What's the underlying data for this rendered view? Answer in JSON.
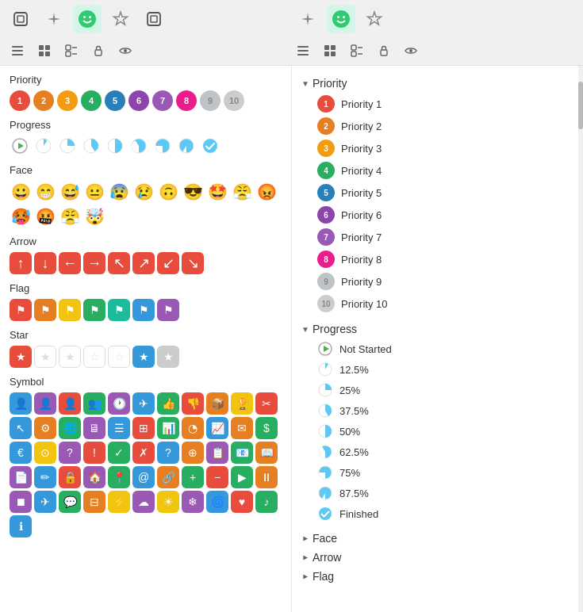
{
  "toolbar": {
    "left": [
      {
        "name": "square-icon",
        "symbol": "⊡",
        "active": false
      },
      {
        "name": "sparkle-icon",
        "symbol": "✦",
        "active": false
      },
      {
        "name": "smiley-icon",
        "symbol": "😊",
        "active": true
      },
      {
        "name": "star-outline-icon",
        "symbol": "✿",
        "active": false
      },
      {
        "name": "square2-icon",
        "symbol": "⊡",
        "active": false
      }
    ],
    "right": [
      {
        "name": "sparkle2-icon",
        "symbol": "✦",
        "active": false
      },
      {
        "name": "smiley2-icon",
        "symbol": "😊",
        "active": true
      },
      {
        "name": "star2-icon",
        "symbol": "✿",
        "active": false
      }
    ]
  },
  "subToolbar": {
    "left": [
      "list",
      "grid",
      "expand",
      "lock",
      "eye"
    ],
    "right": [
      "list",
      "grid",
      "expand",
      "lock",
      "eye"
    ]
  },
  "leftPanel": {
    "sections": [
      {
        "label": "Priority",
        "type": "priority"
      },
      {
        "label": "Progress",
        "type": "progress"
      },
      {
        "label": "Face",
        "type": "face"
      },
      {
        "label": "Arrow",
        "type": "arrow"
      },
      {
        "label": "Flag",
        "type": "flag"
      },
      {
        "label": "Star",
        "type": "star"
      },
      {
        "label": "Symbol",
        "type": "symbol"
      }
    ],
    "priority": {
      "colors": [
        "#e74c3c",
        "#e67e22",
        "#f39c12",
        "#27ae60",
        "#2980b9",
        "#8e44ad",
        "#9b59b6",
        "#e91e8c",
        "#bdc3c7",
        "#ccc"
      ],
      "labels": [
        "1",
        "2",
        "3",
        "4",
        "5",
        "6",
        "7",
        "8",
        "9",
        "10"
      ]
    }
  },
  "rightPanel": {
    "categories": [
      {
        "name": "Priority",
        "expanded": true,
        "items": [
          {
            "label": "Priority 1",
            "color": "#e74c3c",
            "num": "1"
          },
          {
            "label": "Priority 2",
            "color": "#e67e22",
            "num": "2"
          },
          {
            "label": "Priority 3",
            "color": "#f39c12",
            "num": "3"
          },
          {
            "label": "Priority 4",
            "color": "#27ae60",
            "num": "4"
          },
          {
            "label": "Priority 5",
            "color": "#2980b9",
            "num": "5"
          },
          {
            "label": "Priority 6",
            "color": "#8e44ad",
            "num": "6"
          },
          {
            "label": "Priority 7",
            "color": "#9b59b6",
            "num": "7"
          },
          {
            "label": "Priority 8",
            "color": "#e91e8c",
            "num": "8"
          },
          {
            "label": "Priority 9",
            "color": "#bdc3c7",
            "num": "9"
          },
          {
            "label": "Priority 10",
            "color": "#ccc",
            "num": "10"
          }
        ]
      },
      {
        "name": "Progress",
        "expanded": true,
        "items": [
          {
            "label": "Not Started",
            "pct": 0
          },
          {
            "label": "12.5%",
            "pct": 12.5
          },
          {
            "label": "25%",
            "pct": 25
          },
          {
            "label": "37.5%",
            "pct": 37.5
          },
          {
            "label": "50%",
            "pct": 50
          },
          {
            "label": "62.5%",
            "pct": 62.5
          },
          {
            "label": "75%",
            "pct": 75
          },
          {
            "label": "87.5%",
            "pct": 87.5
          },
          {
            "label": "Finished",
            "pct": 100
          }
        ]
      },
      {
        "name": "Face",
        "expanded": false,
        "items": []
      },
      {
        "name": "Arrow",
        "expanded": false,
        "items": []
      },
      {
        "name": "Flag",
        "expanded": false,
        "items": []
      }
    ]
  }
}
